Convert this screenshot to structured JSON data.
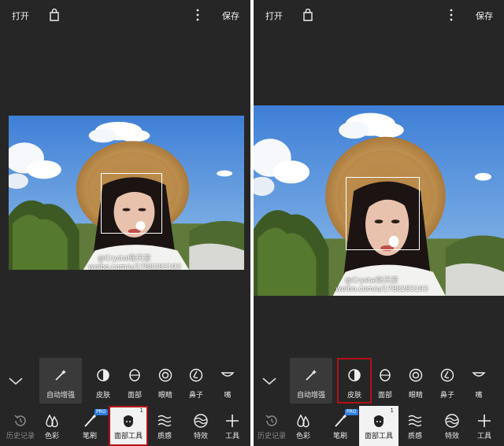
{
  "topbar": {
    "open_label": "打开",
    "save_label": "保存"
  },
  "watermark": {
    "line1": "@Crystal张天爱",
    "line2": "weibo.com/u/1788283193"
  },
  "subtools": {
    "auto": "自动增强",
    "items": [
      "皮肤",
      "面部",
      "眼睛",
      "鼻子",
      "嘴"
    ]
  },
  "bottom": {
    "history": "历史记录",
    "color": "色彩",
    "brush": "笔刷",
    "pro_badge": "PRO",
    "face_tools": "面部工具",
    "face_tools_badge": "1",
    "texture": "质感",
    "effects": "特效",
    "tools": "工具"
  },
  "colors": {
    "highlight": "#b31018",
    "background": "#262626",
    "active_tab": "#f2f2f2",
    "pro_badge": "#2f7fe0"
  },
  "icons": [
    "bag-icon",
    "more-vert-icon",
    "magic-wand-icon",
    "skin-icon",
    "face-icon",
    "eye-icon",
    "nose-icon",
    "mouth-icon",
    "history-icon",
    "color-drop-icon",
    "brush-icon",
    "face-tools-icon",
    "texture-icon",
    "effects-icon",
    "plus-icon",
    "chevron-down-icon"
  ]
}
